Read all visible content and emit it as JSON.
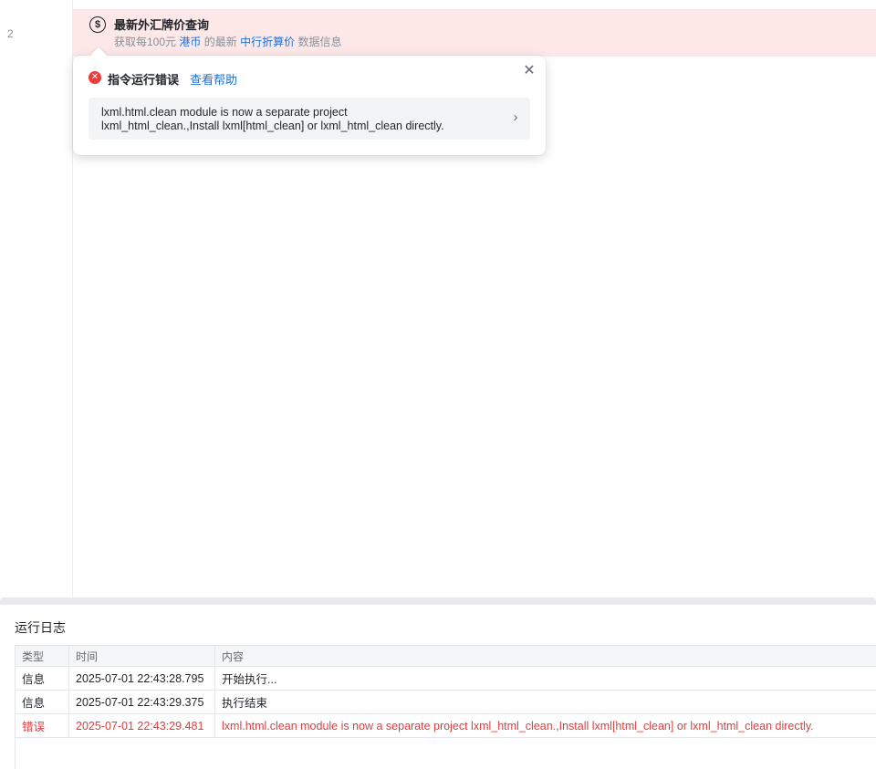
{
  "editor": {
    "line_number": "2",
    "command": {
      "icon": "currency-exchange-icon",
      "title": "最新外汇牌价查询",
      "desc_prefix": "获取每100元",
      "currency": "港币",
      "desc_middle": "的最新",
      "rate_type": "中行折算价",
      "desc_suffix": "数据信息"
    }
  },
  "error_popup": {
    "icon": "error-circle-icon",
    "title": "指令运行错误",
    "help_link": "查看帮助",
    "message_line1": "lxml.html.clean module is now a separate project",
    "message_line2": "lxml_html_clean.,Install lxml[html_clean] or lxml_html_clean directly.",
    "close_icon": "close-icon",
    "chevron_icon": "chevron-right-icon"
  },
  "log": {
    "title": "运行日志",
    "columns": [
      "类型",
      "时间",
      "内容"
    ],
    "rows": [
      {
        "type": "信息",
        "time": "2025-07-01 22:43:28.795",
        "content": "开始执行..."
      },
      {
        "type": "信息",
        "time": "2025-07-01 22:43:29.375",
        "content": "执行结束"
      },
      {
        "type": "错误",
        "time": "2025-07-01 22:43:29.481",
        "content": "lxml.html.clean module is now a separate project lxml_html_clean.,Install lxml[html_clean] or lxml_html_clean directly."
      }
    ]
  },
  "colors": {
    "error_row_bg": "#fde8e8",
    "link_blue": "#1d6fd8",
    "error_red": "#e33b3b"
  }
}
